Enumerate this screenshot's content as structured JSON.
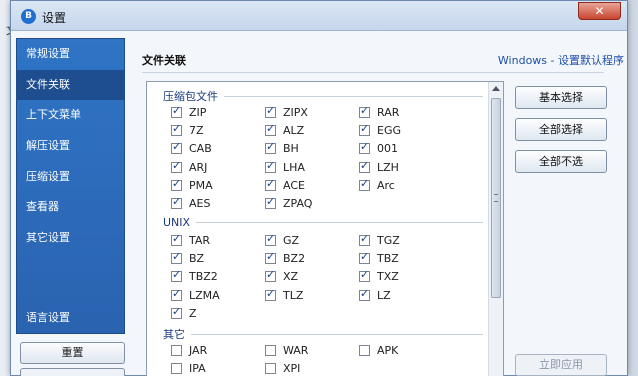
{
  "background_app": {
    "title_fragment": "D...",
    "menu_fragment": "文"
  },
  "window": {
    "title": "设置",
    "icon_letter": "B",
    "close_glyph": "✕"
  },
  "sidebar": {
    "items": [
      {
        "label": "常规设置",
        "active": false
      },
      {
        "label": "文件关联",
        "active": true
      },
      {
        "label": "上下文菜单",
        "active": false
      },
      {
        "label": "解压设置",
        "active": false
      },
      {
        "label": "压缩设置",
        "active": false
      },
      {
        "label": "查看器",
        "active": false
      },
      {
        "label": "其它设置",
        "active": false
      }
    ],
    "language_label": "语言设置",
    "reset_label": "重置"
  },
  "main": {
    "title": "文件关联",
    "windows_link": "Windows - 设置默认程序",
    "groups": [
      {
        "header": "压缩包文件",
        "items": [
          {
            "label": "ZIP",
            "checked": true
          },
          {
            "label": "ZIPX",
            "checked": true
          },
          {
            "label": "RAR",
            "checked": true
          },
          {
            "label": "7Z",
            "checked": true
          },
          {
            "label": "ALZ",
            "checked": true
          },
          {
            "label": "EGG",
            "checked": true
          },
          {
            "label": "CAB",
            "checked": true
          },
          {
            "label": "BH",
            "checked": true
          },
          {
            "label": "001",
            "checked": true
          },
          {
            "label": "ARJ",
            "checked": true
          },
          {
            "label": "LHA",
            "checked": true
          },
          {
            "label": "LZH",
            "checked": true
          },
          {
            "label": "PMA",
            "checked": true
          },
          {
            "label": "ACE",
            "checked": true
          },
          {
            "label": "Arc",
            "checked": true
          },
          {
            "label": "AES",
            "checked": true
          },
          {
            "label": "ZPAQ",
            "checked": true
          }
        ]
      },
      {
        "header": "UNIX",
        "items": [
          {
            "label": "TAR",
            "checked": true
          },
          {
            "label": "GZ",
            "checked": true
          },
          {
            "label": "TGZ",
            "checked": true
          },
          {
            "label": "BZ",
            "checked": true
          },
          {
            "label": "BZ2",
            "checked": true
          },
          {
            "label": "TBZ",
            "checked": true
          },
          {
            "label": "TBZ2",
            "checked": true
          },
          {
            "label": "XZ",
            "checked": true
          },
          {
            "label": "TXZ",
            "checked": true
          },
          {
            "label": "LZMA",
            "checked": true
          },
          {
            "label": "TLZ",
            "checked": true
          },
          {
            "label": "LZ",
            "checked": true
          },
          {
            "label": "Z",
            "checked": true
          }
        ]
      },
      {
        "header": "其它",
        "items": [
          {
            "label": "JAR",
            "checked": false
          },
          {
            "label": "WAR",
            "checked": false
          },
          {
            "label": "APK",
            "checked": false
          },
          {
            "label": "IPA",
            "checked": false
          },
          {
            "label": "XPI",
            "checked": false
          }
        ]
      }
    ],
    "buttons": {
      "basic_select": "基本选择",
      "select_all": "全部选择",
      "select_none": "全部不选",
      "apply_now": "立即应用"
    }
  },
  "colors": {
    "sidebar_bg": "#2f74c5",
    "sidebar_active": "#1e4e8f",
    "link": "#1d4fa8",
    "close_red": "#c8452f"
  }
}
